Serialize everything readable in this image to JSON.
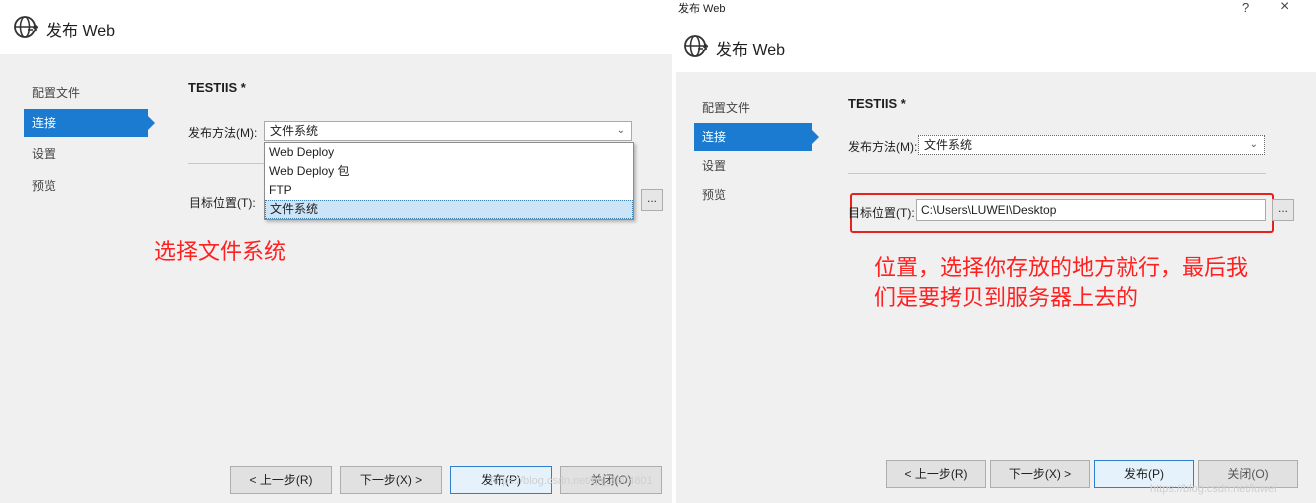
{
  "left": {
    "title": "发布 Web",
    "nav": [
      "配置文件",
      "连接",
      "设置",
      "预览"
    ],
    "profile_name": "TESTIIS *",
    "publish_method_label": "发布方法(M):",
    "publish_method_value": "文件系统",
    "dropdown_options": [
      "Web Deploy",
      "Web Deploy 包",
      "FTP",
      "文件系统"
    ],
    "target_label": "目标位置(T):",
    "browse_label": "...",
    "annotation": "选择文件系统",
    "buttons": {
      "prev": "< 上一步(R)",
      "next": "下一步(X) >",
      "publish": "发布(P)",
      "close": "关闭(O)"
    },
    "watermark": "https://blog.csdn.net/qq_3804801"
  },
  "right": {
    "window_title": "发布 Web",
    "help_label": "?",
    "close_label": "×",
    "title": "发布 Web",
    "nav": [
      "配置文件",
      "连接",
      "设置",
      "预览"
    ],
    "profile_name": "TESTIIS *",
    "publish_method_label": "发布方法(M):",
    "publish_method_value": "文件系统",
    "target_label": "目标位置(T):",
    "target_value": "C:\\Users\\LUWEI\\Desktop",
    "browse_label": "...",
    "annotation_line1": "位置，选择你存放的地方就行，最后我",
    "annotation_line2": "们是要拷贝到服务器上去的",
    "buttons": {
      "prev": "< 上一步(R)",
      "next": "下一步(X) >",
      "publish": "发布(P)",
      "close": "关闭(O)"
    },
    "watermark": "https://blog.csdn.net/luwei"
  },
  "colors": {
    "accent": "#1a7bd0",
    "annotation": "#ff2020",
    "panel_bg": "#f0f0f0"
  },
  "icons": [
    "globe-publish-icon",
    "chevron-down-icon"
  ]
}
